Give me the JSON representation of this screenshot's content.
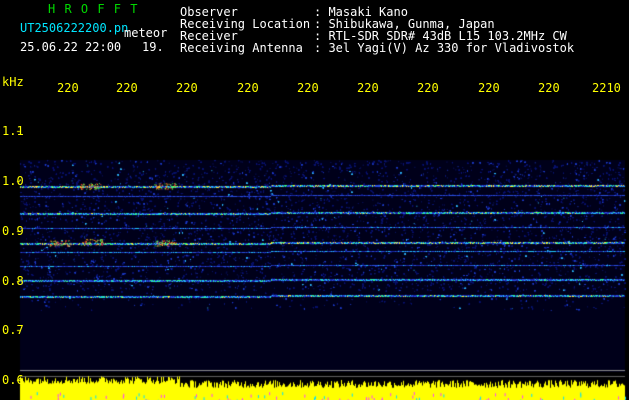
{
  "header": {
    "program": "H R O F F T",
    "filename": "UT2506222200.pn",
    "date_time": "25.06.22 22:00",
    "suffix": "19.",
    "meteor_label": "meteor"
  },
  "info": {
    "labels": [
      "Observer",
      "Receiving Location",
      "Receiver",
      "Receiving Antenna"
    ],
    "values": [
      ": Masaki Kano",
      ": Shibukawa, Gunma, Japan",
      ": RTL-SDR SDR# 43dB L15 103.2MHz CW",
      ": 3el Yagi(V) Az 330 for Vladivostok"
    ]
  },
  "axes": {
    "y_unit": "kHz",
    "y_ticks": [
      "1.1",
      "1.0",
      "0.9",
      "0.8",
      "0.7",
      "0.6"
    ],
    "x_ticks": [
      "220",
      "220",
      "220",
      "220",
      "220",
      "220",
      "220",
      "220",
      "220",
      "2210"
    ]
  },
  "colors": {
    "background": "#000000",
    "axis_text": "#ffff00",
    "program": "#00d800",
    "filename": "#00e6ff",
    "signal_low": "#1a2aa8",
    "signal_high": "#ff3a2a"
  }
}
